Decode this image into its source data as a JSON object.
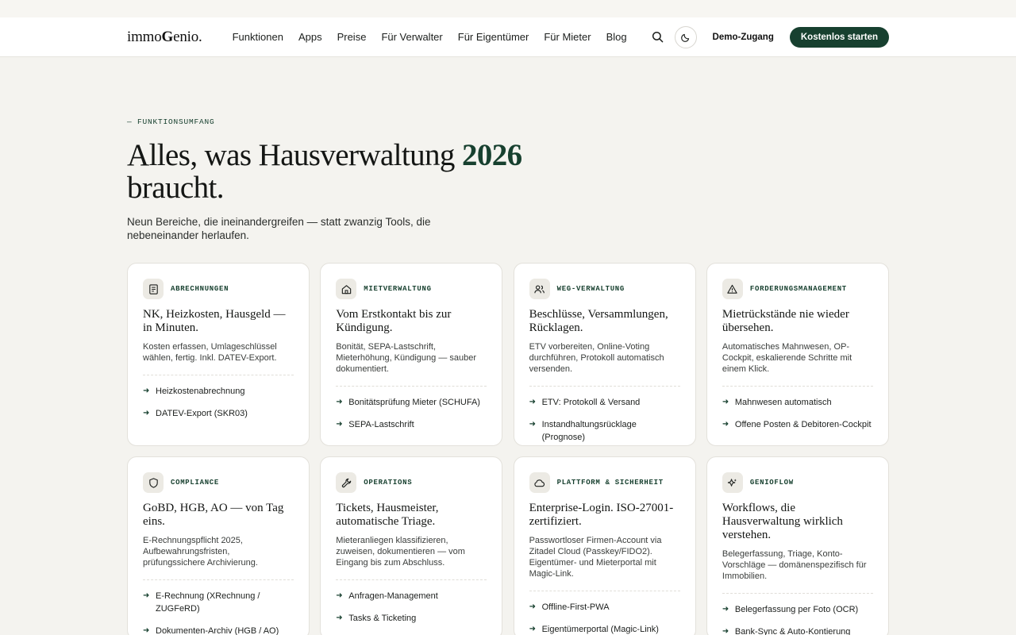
{
  "logo": {
    "part1": "immo",
    "part2": "G",
    "part3": "enio."
  },
  "nav": [
    "Funktionen",
    "Apps",
    "Preise",
    "Für Verwalter",
    "Für Eigentümer",
    "Für Mieter",
    "Blog"
  ],
  "header": {
    "demo_label": "Demo-Zugang",
    "cta_label": "Kostenlos starten"
  },
  "hero": {
    "eyebrow": "— FUNKTIONSUMFANG",
    "title_a": "Alles, was Hausverwaltung ",
    "title_year": "2026",
    "title_b": "braucht.",
    "lede": "Neun Bereiche, die ineinandergreifen — statt zwanzig Tools, die nebeneinander herlaufen."
  },
  "cards": [
    {
      "icon": "document-icon",
      "tag": "ABRECHNUNGEN",
      "title": "NK, Heizkosten, Hausgeld — in Minuten.",
      "text": "Kosten erfassen, Umlageschlüssel wählen, fertig. Inkl. DATEV-Export.",
      "features": [
        "Heizkostenabrechnung",
        "DATEV-Export (SKR03)"
      ]
    },
    {
      "icon": "home-icon",
      "tag": "MIETVERWALTUNG",
      "title": "Vom Erstkontakt bis zur Kündigung.",
      "text": "Bonität, SEPA-Lastschrift, Mieterhöhung, Kündigung — sauber dokumentiert.",
      "features": [
        "Bonitätsprüfung Mieter (SCHUFA)",
        "SEPA-Lastschrift"
      ]
    },
    {
      "icon": "users-icon",
      "tag": "WEG-VERWALTUNG",
      "title": "Beschlüsse, Versammlungen, Rücklagen.",
      "text": "ETV vorbereiten, Online-Voting durchführen, Protokoll automatisch versenden.",
      "features": [
        "ETV: Protokoll & Versand",
        "Instandhaltungsrücklage (Prognose)"
      ]
    },
    {
      "icon": "warning-icon",
      "tag": "FORDERUNGSMANAGEMENT",
      "title": "Mietrückstände nie wieder übersehen.",
      "text": "Automatisches Mahnwesen, OP-Cockpit, eskalierende Schritte mit einem Klick.",
      "features": [
        "Mahnwesen automatisch",
        "Offene Posten & Debitoren-Cockpit"
      ]
    },
    {
      "icon": "shield-icon",
      "tag": "COMPLIANCE",
      "title": "GoBD, HGB, AO — von Tag eins.",
      "text": "E-Rechnungspflicht 2025, Aufbewahrungsfristen, prüfungssichere Archivierung.",
      "features": [
        "E-Rechnung (XRechnung / ZUGFeRD)",
        "Dokumenten-Archiv (HGB / AO)"
      ]
    },
    {
      "icon": "wrench-icon",
      "tag": "OPERATIONS",
      "title": "Tickets, Hausmeister, automatische Triage.",
      "text": "Mieteranliegen klassifizieren, zuweisen, dokumentieren — vom Eingang bis zum Abschluss.",
      "features": [
        "Anfragen-Management",
        "Tasks & Ticketing"
      ]
    },
    {
      "icon": "cloud-icon",
      "tag": "PLATTFORM & SICHERHEIT",
      "title": "Enterprise-Login. ISO-27001-zertifiziert.",
      "text": "Passwortloser Firmen-Account via Zitadel Cloud (Passkey/FIDO2). Eigentümer- und Mieterportal mit Magic-Link.",
      "features": [
        "Offline-First-PWA",
        "Eigentümerportal (Magic-Link)"
      ]
    },
    {
      "icon": "sparkle-icon",
      "tag": "GENIOFLOW",
      "title": "Workflows, die Hausverwaltung wirklich verstehen.",
      "text": "Belegerfassung, Triage, Konto-Vorschläge — domänenspezifisch für Immobilien.",
      "features": [
        "Belegerfassung per Foto (OCR)",
        "Bank-Sync & Auto-Kontierung"
      ]
    }
  ]
}
